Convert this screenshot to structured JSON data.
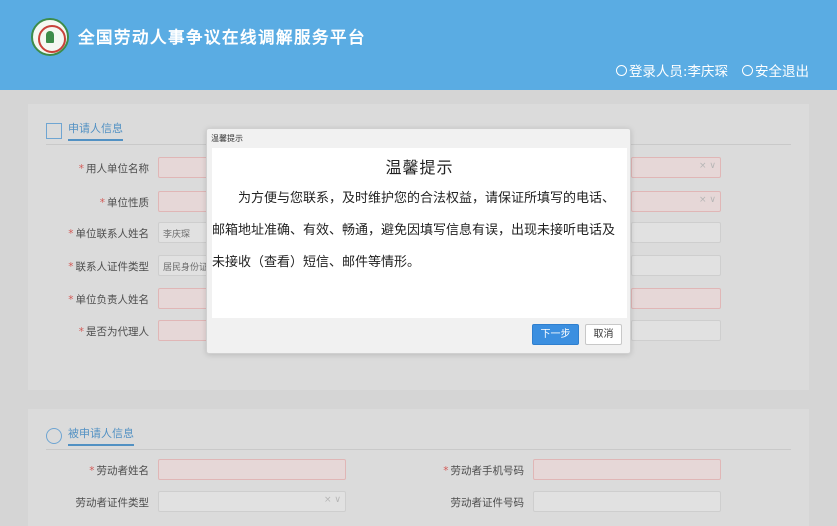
{
  "header": {
    "site_title": "全国劳动人事争议在线调解服务平台",
    "login_label": "登录人员:李庆琛",
    "logout_label": "安全退出"
  },
  "applicant_section": {
    "title": "申请人信息",
    "fields": [
      {
        "label": "用人单位名称",
        "required": true,
        "value": ""
      },
      {
        "label": "单位性质",
        "required": true,
        "value": ""
      },
      {
        "label": "单位联系人姓名",
        "required": true,
        "value": "李庆琛"
      },
      {
        "label": "联系人证件类型",
        "required": true,
        "value": "居民身份证"
      },
      {
        "label": "单位负责人姓名",
        "required": true,
        "value": ""
      },
      {
        "label": "是否为代理人",
        "required": true,
        "value": ""
      }
    ]
  },
  "respondent_section": {
    "title": "被申请人信息",
    "fields": [
      {
        "label": "劳动者姓名",
        "required": true,
        "value": ""
      },
      {
        "label": "劳动者手机号码",
        "required": true,
        "value": ""
      },
      {
        "label": "劳动者证件类型",
        "required": false,
        "value": ""
      },
      {
        "label": "劳动者证件号码",
        "required": false,
        "value": ""
      }
    ]
  },
  "dialog": {
    "window_title": "温馨提示",
    "heading": "温馨提示",
    "message": "为方便与您联系，及时维护您的合法权益，请保证所填写的电话、邮箱地址准确、有效、畅通，避免因填写信息有误，出现未接听电话及未接收（查看）短信、邮件等情形。",
    "next_label": "下一步",
    "cancel_label": "取消"
  },
  "colors": {
    "header_bg": "#5aace3",
    "accent": "#4a90c8",
    "primary_button": "#3b8fe0",
    "required_mark": "#d9534f"
  }
}
